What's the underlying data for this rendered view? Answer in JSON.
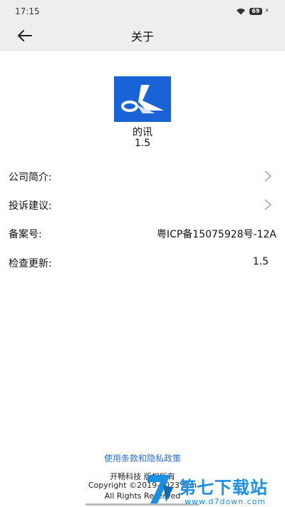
{
  "status_bar": {
    "time": "17:15",
    "battery": "69"
  },
  "header": {
    "title": "关于"
  },
  "app": {
    "name": "的讯",
    "version": "1.5"
  },
  "rows": [
    {
      "label": "公司简介:"
    },
    {
      "label": "投诉建议:"
    },
    {
      "label": "备案号:",
      "value": "粤ICP备15075928号-12A"
    },
    {
      "label": "检查更新:",
      "value": "1.5"
    }
  ],
  "footer": {
    "policy_link": "使用条款和隐私政策",
    "company": "开畅科技 版权所有",
    "copyright": "Copyright ©2019-2023 Kun",
    "rights": "All Rights Reserved"
  },
  "watermark": {
    "title": "第七下载站",
    "url": "www.d7down.com"
  },
  "colors": {
    "header_bg": "#eeeeee",
    "logo_bg": "#1a63d6",
    "link": "#2a6fd6",
    "watermark": "#1a8fe3"
  }
}
